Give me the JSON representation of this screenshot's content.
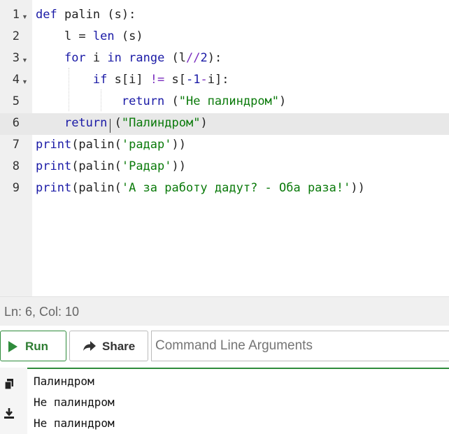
{
  "editor": {
    "lines": [
      {
        "num": "1",
        "fold": true,
        "tokens": [
          {
            "t": "def ",
            "c": "kw"
          },
          {
            "t": "palin (s):",
            "c": ""
          }
        ]
      },
      {
        "num": "2",
        "fold": false,
        "tokens": [
          {
            "t": "    l = ",
            "c": ""
          },
          {
            "t": "len",
            "c": "fn"
          },
          {
            "t": " (s)",
            "c": ""
          }
        ]
      },
      {
        "num": "3",
        "fold": true,
        "tokens": [
          {
            "t": "    ",
            "c": ""
          },
          {
            "t": "for",
            "c": "kw"
          },
          {
            "t": " i ",
            "c": ""
          },
          {
            "t": "in",
            "c": "kw"
          },
          {
            "t": " ",
            "c": ""
          },
          {
            "t": "range",
            "c": "fn"
          },
          {
            "t": " (l",
            "c": ""
          },
          {
            "t": "//",
            "c": "op"
          },
          {
            "t": "2",
            "c": "num"
          },
          {
            "t": "):",
            "c": ""
          }
        ]
      },
      {
        "num": "4",
        "fold": true,
        "tokens": [
          {
            "t": "        ",
            "c": ""
          },
          {
            "t": "if",
            "c": "kw"
          },
          {
            "t": " s[i] ",
            "c": ""
          },
          {
            "t": "!=",
            "c": "op"
          },
          {
            "t": " s[",
            "c": ""
          },
          {
            "t": "-1",
            "c": "num"
          },
          {
            "t": "-",
            "c": "op"
          },
          {
            "t": "i]:",
            "c": ""
          }
        ]
      },
      {
        "num": "5",
        "fold": false,
        "tokens": [
          {
            "t": "            ",
            "c": ""
          },
          {
            "t": "return",
            "c": "kw"
          },
          {
            "t": " (",
            "c": ""
          },
          {
            "t": "\"Не палиндром\"",
            "c": "str"
          },
          {
            "t": ")",
            "c": ""
          }
        ]
      },
      {
        "num": "6",
        "fold": false,
        "active": true,
        "tokens": [
          {
            "t": "    ",
            "c": ""
          },
          {
            "t": "return",
            "c": "kw"
          },
          {
            "t": " (",
            "c": ""
          },
          {
            "t": "\"Палиндром\"",
            "c": "str"
          },
          {
            "t": ")",
            "c": ""
          }
        ]
      },
      {
        "num": "7",
        "fold": false,
        "tokens": [
          {
            "t": "print",
            "c": "kw"
          },
          {
            "t": "(palin(",
            "c": ""
          },
          {
            "t": "'радар'",
            "c": "str"
          },
          {
            "t": "))",
            "c": ""
          }
        ]
      },
      {
        "num": "8",
        "fold": false,
        "tokens": [
          {
            "t": "print",
            "c": "kw"
          },
          {
            "t": "(palin(",
            "c": ""
          },
          {
            "t": "'Радар'",
            "c": "str"
          },
          {
            "t": "))",
            "c": ""
          }
        ]
      },
      {
        "num": "9",
        "fold": false,
        "tokens": [
          {
            "t": "print",
            "c": "kw"
          },
          {
            "t": "(palin(",
            "c": ""
          },
          {
            "t": "'А за работу дадут? - Оба раза!'",
            "c": "str"
          },
          {
            "t": "))",
            "c": ""
          }
        ]
      }
    ]
  },
  "status": {
    "text": "Ln: 6,  Col: 10"
  },
  "toolbar": {
    "run_label": "Run",
    "share_label": "Share",
    "args_placeholder": "Command Line Arguments"
  },
  "output": {
    "lines": [
      "Палиндром",
      "Не палиндром",
      "Не палиндром"
    ],
    "icons": [
      "copy-icon",
      "download-icon"
    ]
  },
  "colors": {
    "accent": "#2e8b3b",
    "keyword": "#1a1aa6",
    "string": "#0a7a0a",
    "operator": "#7a2dbf"
  }
}
